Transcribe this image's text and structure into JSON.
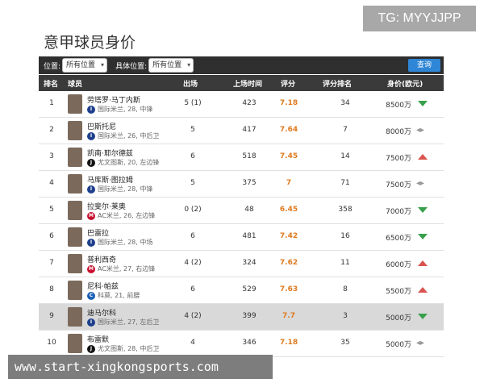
{
  "watermark_tg": "TG: MYYJJPP",
  "title": "意甲球员身价",
  "filters": {
    "position_label": "位置:",
    "position_value": "所有位置",
    "specific_label": "具体位置:",
    "specific_value": "所有位置",
    "search_label": "查询"
  },
  "columns": {
    "rank": "排名",
    "player": "球员",
    "apps": "出场",
    "minutes": "上场时间",
    "rating": "评分",
    "rating_rank": "评分排名",
    "value": "身价(欧元)"
  },
  "rows": [
    {
      "rank": "1",
      "name": "劳塔罗·马丁内斯",
      "club": "国际米兰, 28, 中锋",
      "apps": "5 (1)",
      "minutes": "423",
      "rating": "7.18",
      "rating_rank": "34",
      "value": "8500万",
      "trend": "down"
    },
    {
      "rank": "2",
      "name": "巴斯托尼",
      "club": "国际米兰, 26, 中后卫",
      "apps": "5",
      "minutes": "417",
      "rating": "7.64",
      "rating_rank": "7",
      "value": "8000万",
      "trend": "flat"
    },
    {
      "rank": "3",
      "name": "凯南·耶尔德兹",
      "club": "尤文图斯, 20, 左边锋",
      "apps": "6",
      "minutes": "518",
      "rating": "7.45",
      "rating_rank": "14",
      "value": "7500万",
      "trend": "up"
    },
    {
      "rank": "4",
      "name": "马库斯·图拉姆",
      "club": "国际米兰, 28, 中锋",
      "apps": "5",
      "minutes": "375",
      "rating": "7",
      "rating_rank": "71",
      "value": "7500万",
      "trend": "flat"
    },
    {
      "rank": "5",
      "name": "拉斐尔·莱奥",
      "club": "AC米兰, 26, 左边锋",
      "apps": "0 (2)",
      "minutes": "48",
      "rating": "6.45",
      "rating_rank": "358",
      "value": "7000万",
      "trend": "down"
    },
    {
      "rank": "6",
      "name": "巴雷拉",
      "club": "国际米兰, 28, 中场",
      "apps": "6",
      "minutes": "481",
      "rating": "7.42",
      "rating_rank": "16",
      "value": "6500万",
      "trend": "down"
    },
    {
      "rank": "7",
      "name": "普利西奇",
      "club": "AC米兰, 27, 右边锋",
      "apps": "4 (2)",
      "minutes": "324",
      "rating": "7.62",
      "rating_rank": "11",
      "value": "6000万",
      "trend": "up"
    },
    {
      "rank": "8",
      "name": "尼科·帕兹",
      "club": "科莫, 21, 前腰",
      "apps": "6",
      "minutes": "529",
      "rating": "7.63",
      "rating_rank": "8",
      "value": "5500万",
      "trend": "up"
    },
    {
      "rank": "9",
      "name": "迪马尔科",
      "club": "国际米兰, 27, 左后卫",
      "apps": "4 (2)",
      "minutes": "399",
      "rating": "7.7",
      "rating_rank": "3",
      "value": "5000万",
      "trend": "down"
    },
    {
      "rank": "10",
      "name": "布雷默",
      "club": "尤文图斯, 28, 中后卫",
      "apps": "4",
      "minutes": "346",
      "rating": "7.18",
      "rating_rank": "35",
      "value": "5000万",
      "trend": "flat"
    }
  ],
  "watermark_url": "www.start-xingkongsports.com",
  "colors": {
    "rating": "#e07a1f",
    "down": "#38a04c",
    "up": "#d9534f",
    "header": "#3a3a3a",
    "button": "#2f86d6"
  }
}
